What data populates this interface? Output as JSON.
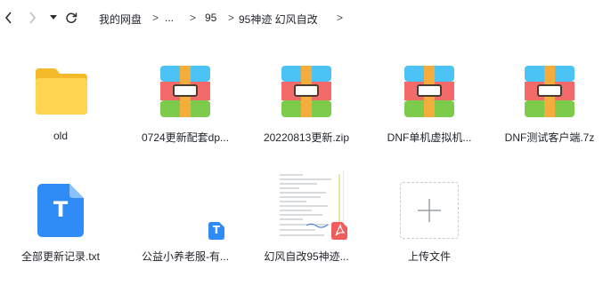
{
  "breadcrumb": {
    "items": [
      "我的网盘",
      "...",
      "95",
      "95神迹 幻风自改"
    ],
    "separator": ">"
  },
  "files": [
    {
      "name": "old",
      "icon": "folder-icon"
    },
    {
      "name": "0724更新配套dp...",
      "icon": "archive-icon"
    },
    {
      "name": "20220813更新.zip",
      "icon": "archive-icon"
    },
    {
      "name": "DNF单机虚拟机...",
      "icon": "archive-icon"
    },
    {
      "name": "DNF测试客户端.7z",
      "icon": "archive-icon"
    },
    {
      "name": "全部更新记录.txt",
      "icon": "text-file-icon",
      "glyph": "T"
    },
    {
      "name": "公益小养老服-有...",
      "icon": "text-file-small-icon",
      "glyph": "T"
    },
    {
      "name": "幻风自改95神迹...",
      "icon": "pdf-file-icon"
    },
    {
      "name": "上传文件",
      "icon": "plus-icon"
    }
  ],
  "colors": {
    "folder": "#ffcf3f",
    "archive_blue": "#4cc3f5",
    "archive_red": "#f26a6a",
    "archive_green": "#7ccb4a",
    "archive_strap": "#f4ad3c",
    "text_file": "#2f8cf6",
    "pdf": "#f05d5d"
  }
}
